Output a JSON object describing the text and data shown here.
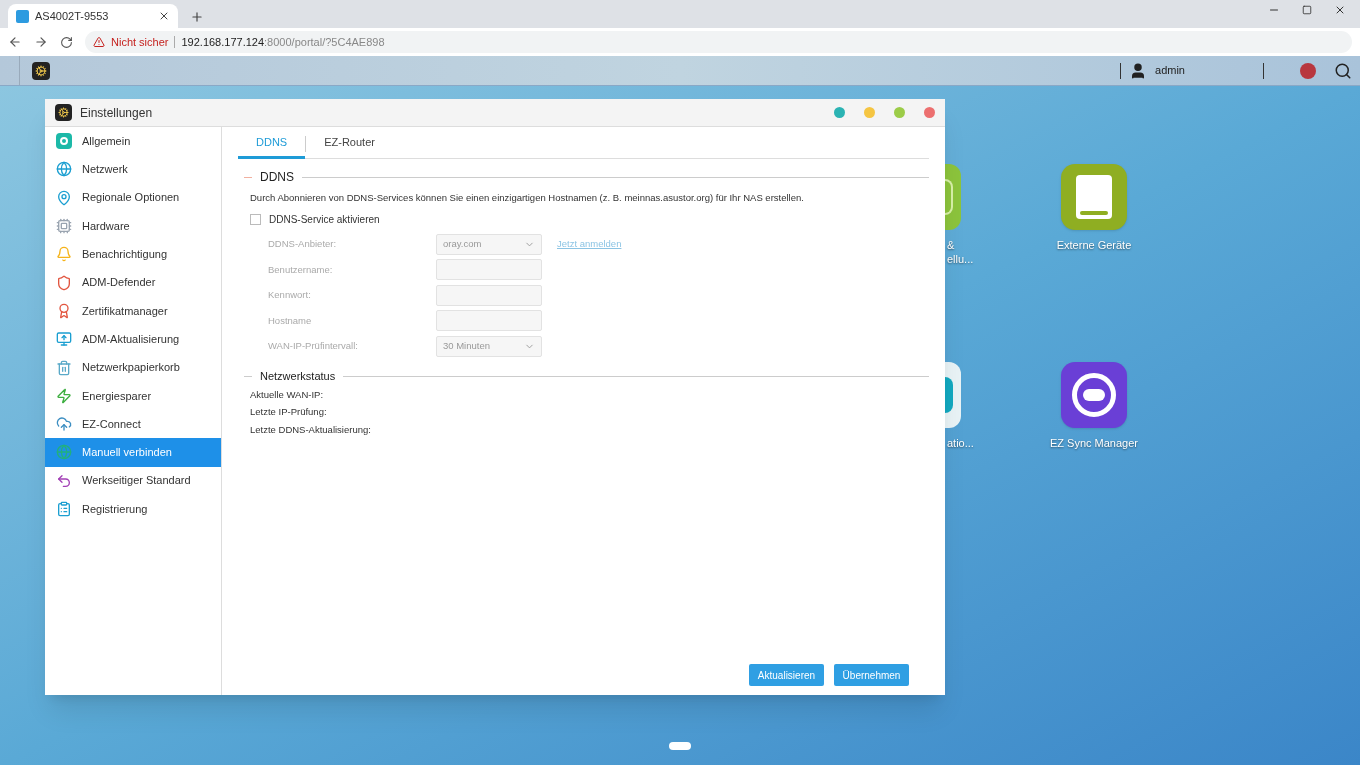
{
  "browser": {
    "tab_title": "AS4002T-9553",
    "security": "Nicht sicher",
    "url_host": "192.168.177.124",
    "url_rest": ":8000/portal/?5C4AE898"
  },
  "top_bar": {
    "user": "admin"
  },
  "desktop_icons": [
    {
      "label_lines": [
        "&",
        "ellu..."
      ],
      "kind": "green"
    },
    {
      "label_lines": [
        "Externe Geräte"
      ],
      "kind": "drive"
    },
    {
      "label_lines": [
        "atio..."
      ],
      "kind": "cyan"
    },
    {
      "label_lines": [
        "EZ Sync Manager"
      ],
      "kind": "sync"
    }
  ],
  "window": {
    "title": "Einstellungen",
    "sidebar": [
      {
        "label": "Allgemein",
        "selected": false
      },
      {
        "label": "Netzwerk",
        "selected": false
      },
      {
        "label": "Regionale Optionen",
        "selected": false
      },
      {
        "label": "Hardware",
        "selected": false
      },
      {
        "label": "Benachrichtigung",
        "selected": false
      },
      {
        "label": "ADM-Defender",
        "selected": false
      },
      {
        "label": "Zertifikatmanager",
        "selected": false
      },
      {
        "label": "ADM-Aktualisierung",
        "selected": false
      },
      {
        "label": "Netzwerkpapierkorb",
        "selected": false
      },
      {
        "label": "Energiesparer",
        "selected": false
      },
      {
        "label": "EZ-Connect",
        "selected": false
      },
      {
        "label": "Manuell verbinden",
        "selected": true
      },
      {
        "label": "Werkseitiger Standard",
        "selected": false
      },
      {
        "label": "Registrierung",
        "selected": false
      }
    ],
    "tabs": [
      {
        "label": "DDNS",
        "selected": true
      },
      {
        "label": "EZ-Router",
        "selected": false
      }
    ],
    "ddns": {
      "heading": "DDNS",
      "description": "Durch Abonnieren von DDNS-Services können Sie einen einzigartigen Hostnamen (z. B. meinnas.asustor.org) für Ihr NAS erstellen.",
      "enable": {
        "label": "DDNS-Service aktivieren",
        "checked": false
      },
      "fields": [
        {
          "kind": "select",
          "label": "DDNS-Anbieter:",
          "value": "oray.com",
          "link": "Jetzt anmelden",
          "disabled": true
        },
        {
          "kind": "text",
          "label": "Benutzername:",
          "disabled": true
        },
        {
          "kind": "text",
          "label": "Kennwort:",
          "disabled": true
        },
        {
          "kind": "text",
          "label": "Hostname",
          "disabled": true
        },
        {
          "kind": "select",
          "label": "WAN-IP-Prüfintervall:",
          "value": "30 Minuten",
          "disabled": true
        }
      ]
    },
    "status": {
      "heading": "Netzwerkstatus",
      "rows": [
        "Aktuelle WAN-IP:",
        "Letzte IP-Prüfung:",
        "Letzte DDNS-Aktualisierung:"
      ]
    },
    "buttons": [
      "Aktualisieren",
      "Übernehmen"
    ]
  }
}
